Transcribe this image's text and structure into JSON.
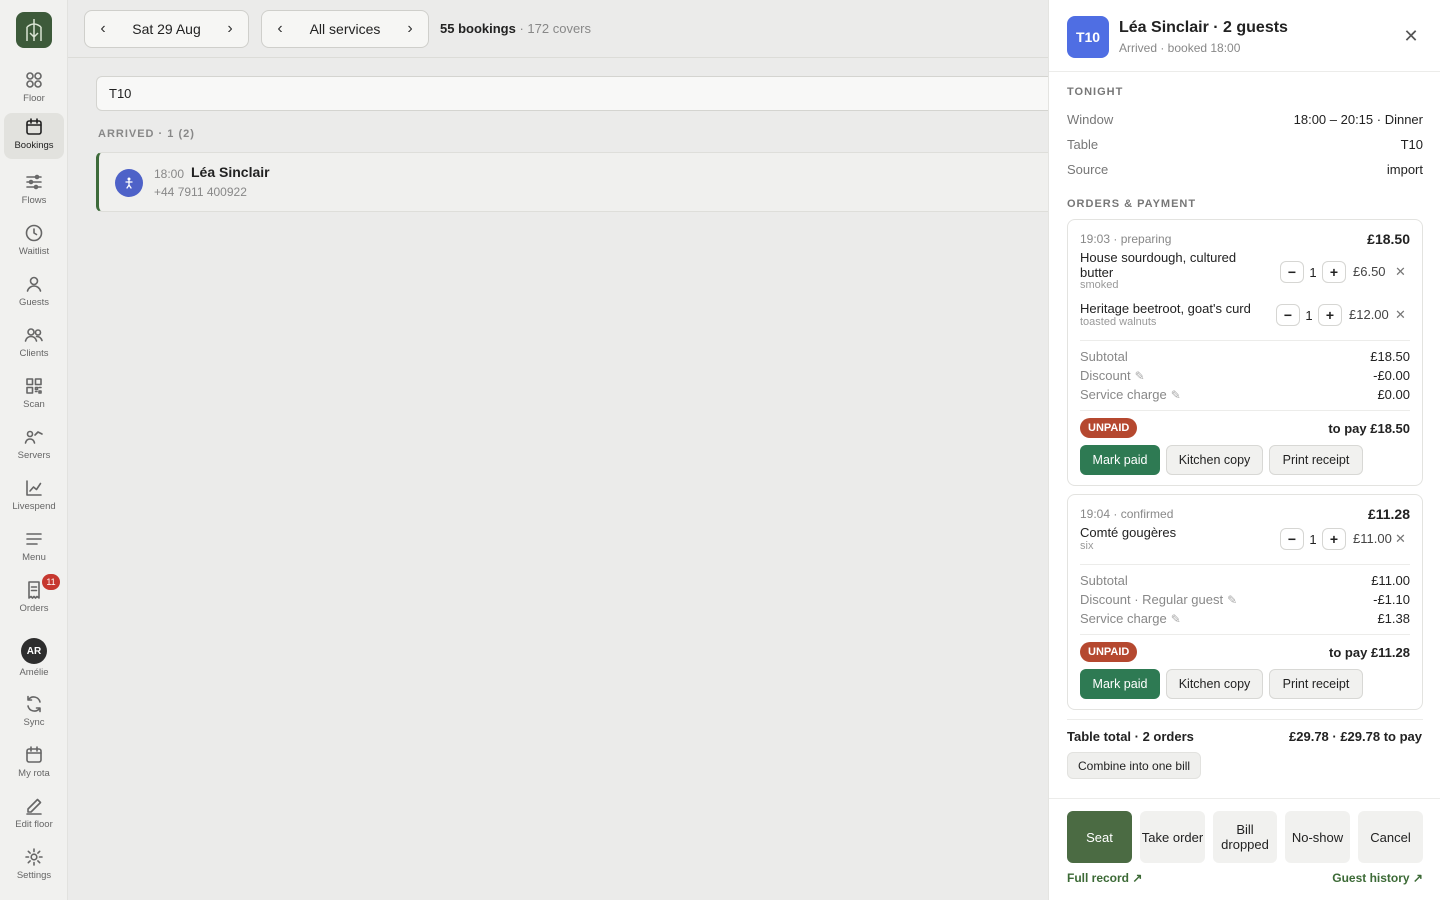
{
  "sidebar": {
    "items": [
      {
        "label": "Floor",
        "icon": "grid-icon"
      },
      {
        "label": "Bookings",
        "icon": "calendar-icon"
      },
      {
        "label": "Flows",
        "icon": "sliders-icon"
      },
      {
        "label": "Waitlist",
        "icon": "clock-icon"
      },
      {
        "label": "Guests",
        "icon": "person-icon"
      },
      {
        "label": "Clients",
        "icon": "people-icon"
      },
      {
        "label": "Scan",
        "icon": "qr-icon"
      },
      {
        "label": "Servers",
        "icon": "servers-icon"
      },
      {
        "label": "Livespend",
        "icon": "chart-icon"
      },
      {
        "label": "Menu",
        "icon": "menu-icon"
      },
      {
        "label": "Orders",
        "icon": "receipt-icon",
        "badge": "11"
      }
    ],
    "user": {
      "initials": "AR",
      "name": "Amélie"
    },
    "bottom": [
      {
        "label": "Sync",
        "icon": "sync-icon"
      },
      {
        "label": "My rota",
        "icon": "calendar-icon"
      },
      {
        "label": "Edit floor",
        "icon": "pencil-icon"
      },
      {
        "label": "Settings",
        "icon": "gear-icon"
      }
    ]
  },
  "topbar": {
    "date": "Sat 29 Aug",
    "service": "All services",
    "bookings": "55 bookings",
    "covers": "· 172 covers"
  },
  "search": {
    "value": "T10"
  },
  "list": {
    "section": "ARRIVED · 1 (2)",
    "booking": {
      "time": "18:00",
      "name": "Léa Sinclair",
      "phone": "+44 7911 400922"
    }
  },
  "panel": {
    "table": "T10",
    "title": "Léa Sinclair · 2 guests",
    "subtitle": "Arrived · booked 18:00",
    "tonight_caption": "TONIGHT",
    "window_label": "Window",
    "window_value": "18:00 – 20:15 · Dinner",
    "table_label": "Table",
    "table_value": "T10",
    "source_label": "Source",
    "source_value": "import",
    "orders_caption": "ORDERS & PAYMENT",
    "orders": [
      {
        "head": "19:03 · preparing",
        "total": "£18.50",
        "items": [
          {
            "name": "House sourdough, cultured butter",
            "note": "smoked",
            "qty": "1",
            "price": "£6.50"
          },
          {
            "name": "Heritage beetroot, goat's curd",
            "note": "toasted walnuts",
            "qty": "1",
            "price": "£12.00"
          }
        ],
        "subtotal_label": "Subtotal",
        "subtotal": "£18.50",
        "discount_label": "Discount",
        "discount": "-£0.00",
        "service_label": "Service charge",
        "service": "£0.00",
        "status": "UNPAID",
        "to_pay": "to pay £18.50",
        "mark_paid": "Mark paid",
        "kitchen_copy": "Kitchen copy",
        "print_receipt": "Print receipt"
      },
      {
        "head": "19:04 · confirmed",
        "total": "£11.28",
        "items": [
          {
            "name": "Comté gougères",
            "note": "six",
            "qty": "1",
            "price": "£11.00"
          }
        ],
        "subtotal_label": "Subtotal",
        "subtotal": "£11.00",
        "discount_label": "Discount · Regular guest",
        "discount": "-£1.10",
        "service_label": "Service charge",
        "service": "£1.38",
        "status": "UNPAID",
        "to_pay": "to pay £11.28",
        "mark_paid": "Mark paid",
        "kitchen_copy": "Kitchen copy",
        "print_receipt": "Print receipt"
      }
    ],
    "table_total_label": "Table total · 2 orders",
    "table_total_value": "£29.78 · £29.78 to pay",
    "combine": "Combine into one bill",
    "actions": {
      "seat": "Seat",
      "take_order": "Take order",
      "bill_dropped": "Bill dropped",
      "no_show": "No-show",
      "cancel": "Cancel"
    },
    "full_record": "Full record ↗",
    "guest_history": "Guest history ↗"
  },
  "colors": {
    "accent": "#3d5a3a",
    "table_badge": "#4f6ee3",
    "unpaid": "#b5482f",
    "primary_button": "#2e7a53"
  }
}
